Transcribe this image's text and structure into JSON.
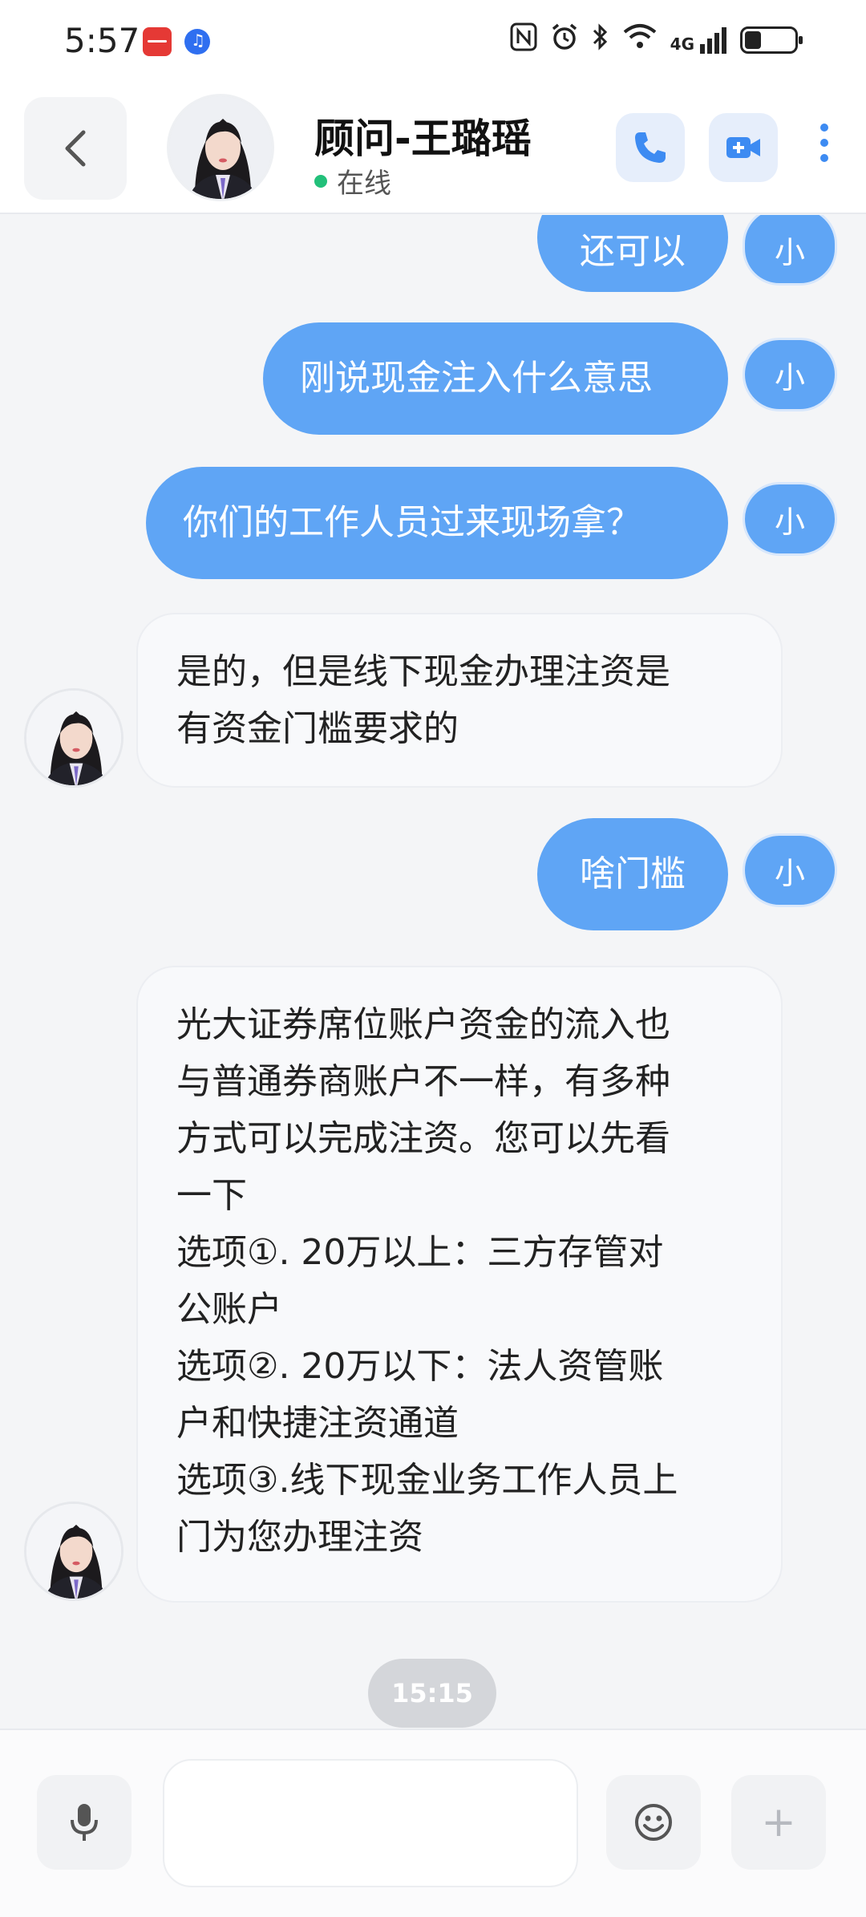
{
  "status_bar": {
    "time": "5:57",
    "network_label": "4G",
    "icons": [
      "nfc-icon",
      "alarm-icon",
      "bluetooth-icon",
      "wifi-icon",
      "signal-icon",
      "battery-icon"
    ],
    "battery_level": 0.3
  },
  "header": {
    "contact_name": "顾问-王璐瑶",
    "status_text": "在线",
    "online_color": "#22c07a",
    "accent_color": "#3d8bf2"
  },
  "messages": [
    {
      "direction": "out",
      "text": "还可以",
      "avatar_label": "小"
    },
    {
      "direction": "out",
      "text": "刚说现金注入什么意思",
      "avatar_label": "小"
    },
    {
      "direction": "out",
      "text": "你们的工作人员过来现场拿？",
      "avatar_label": "小"
    },
    {
      "direction": "in",
      "lines": [
        "是的，但是线下现金办理注资是",
        "有资金门槛要求的"
      ]
    },
    {
      "direction": "out",
      "text": "啥门槛",
      "avatar_label": "小"
    },
    {
      "direction": "in",
      "lines": [
        "光大证券席位账户资金的流入也",
        "与普通券商账户不一样，有多种",
        "方式可以完成注资。您可以先看",
        "一下",
        "选项①. 20万以上：三方存管对",
        "公账户",
        "选项②. 20万以下：法人资管账",
        "户和快捷注资通道",
        "选项③.线下现金业务工作人员上",
        "门为您办理注资"
      ]
    }
  ],
  "time_divider": "15:15",
  "input_bar": {
    "placeholder": "",
    "plus_label": "+"
  },
  "colors": {
    "outgoing_bubble": "#5fa5f5",
    "incoming_bubble": "#f8f9fb",
    "background": "#f4f5f7"
  }
}
